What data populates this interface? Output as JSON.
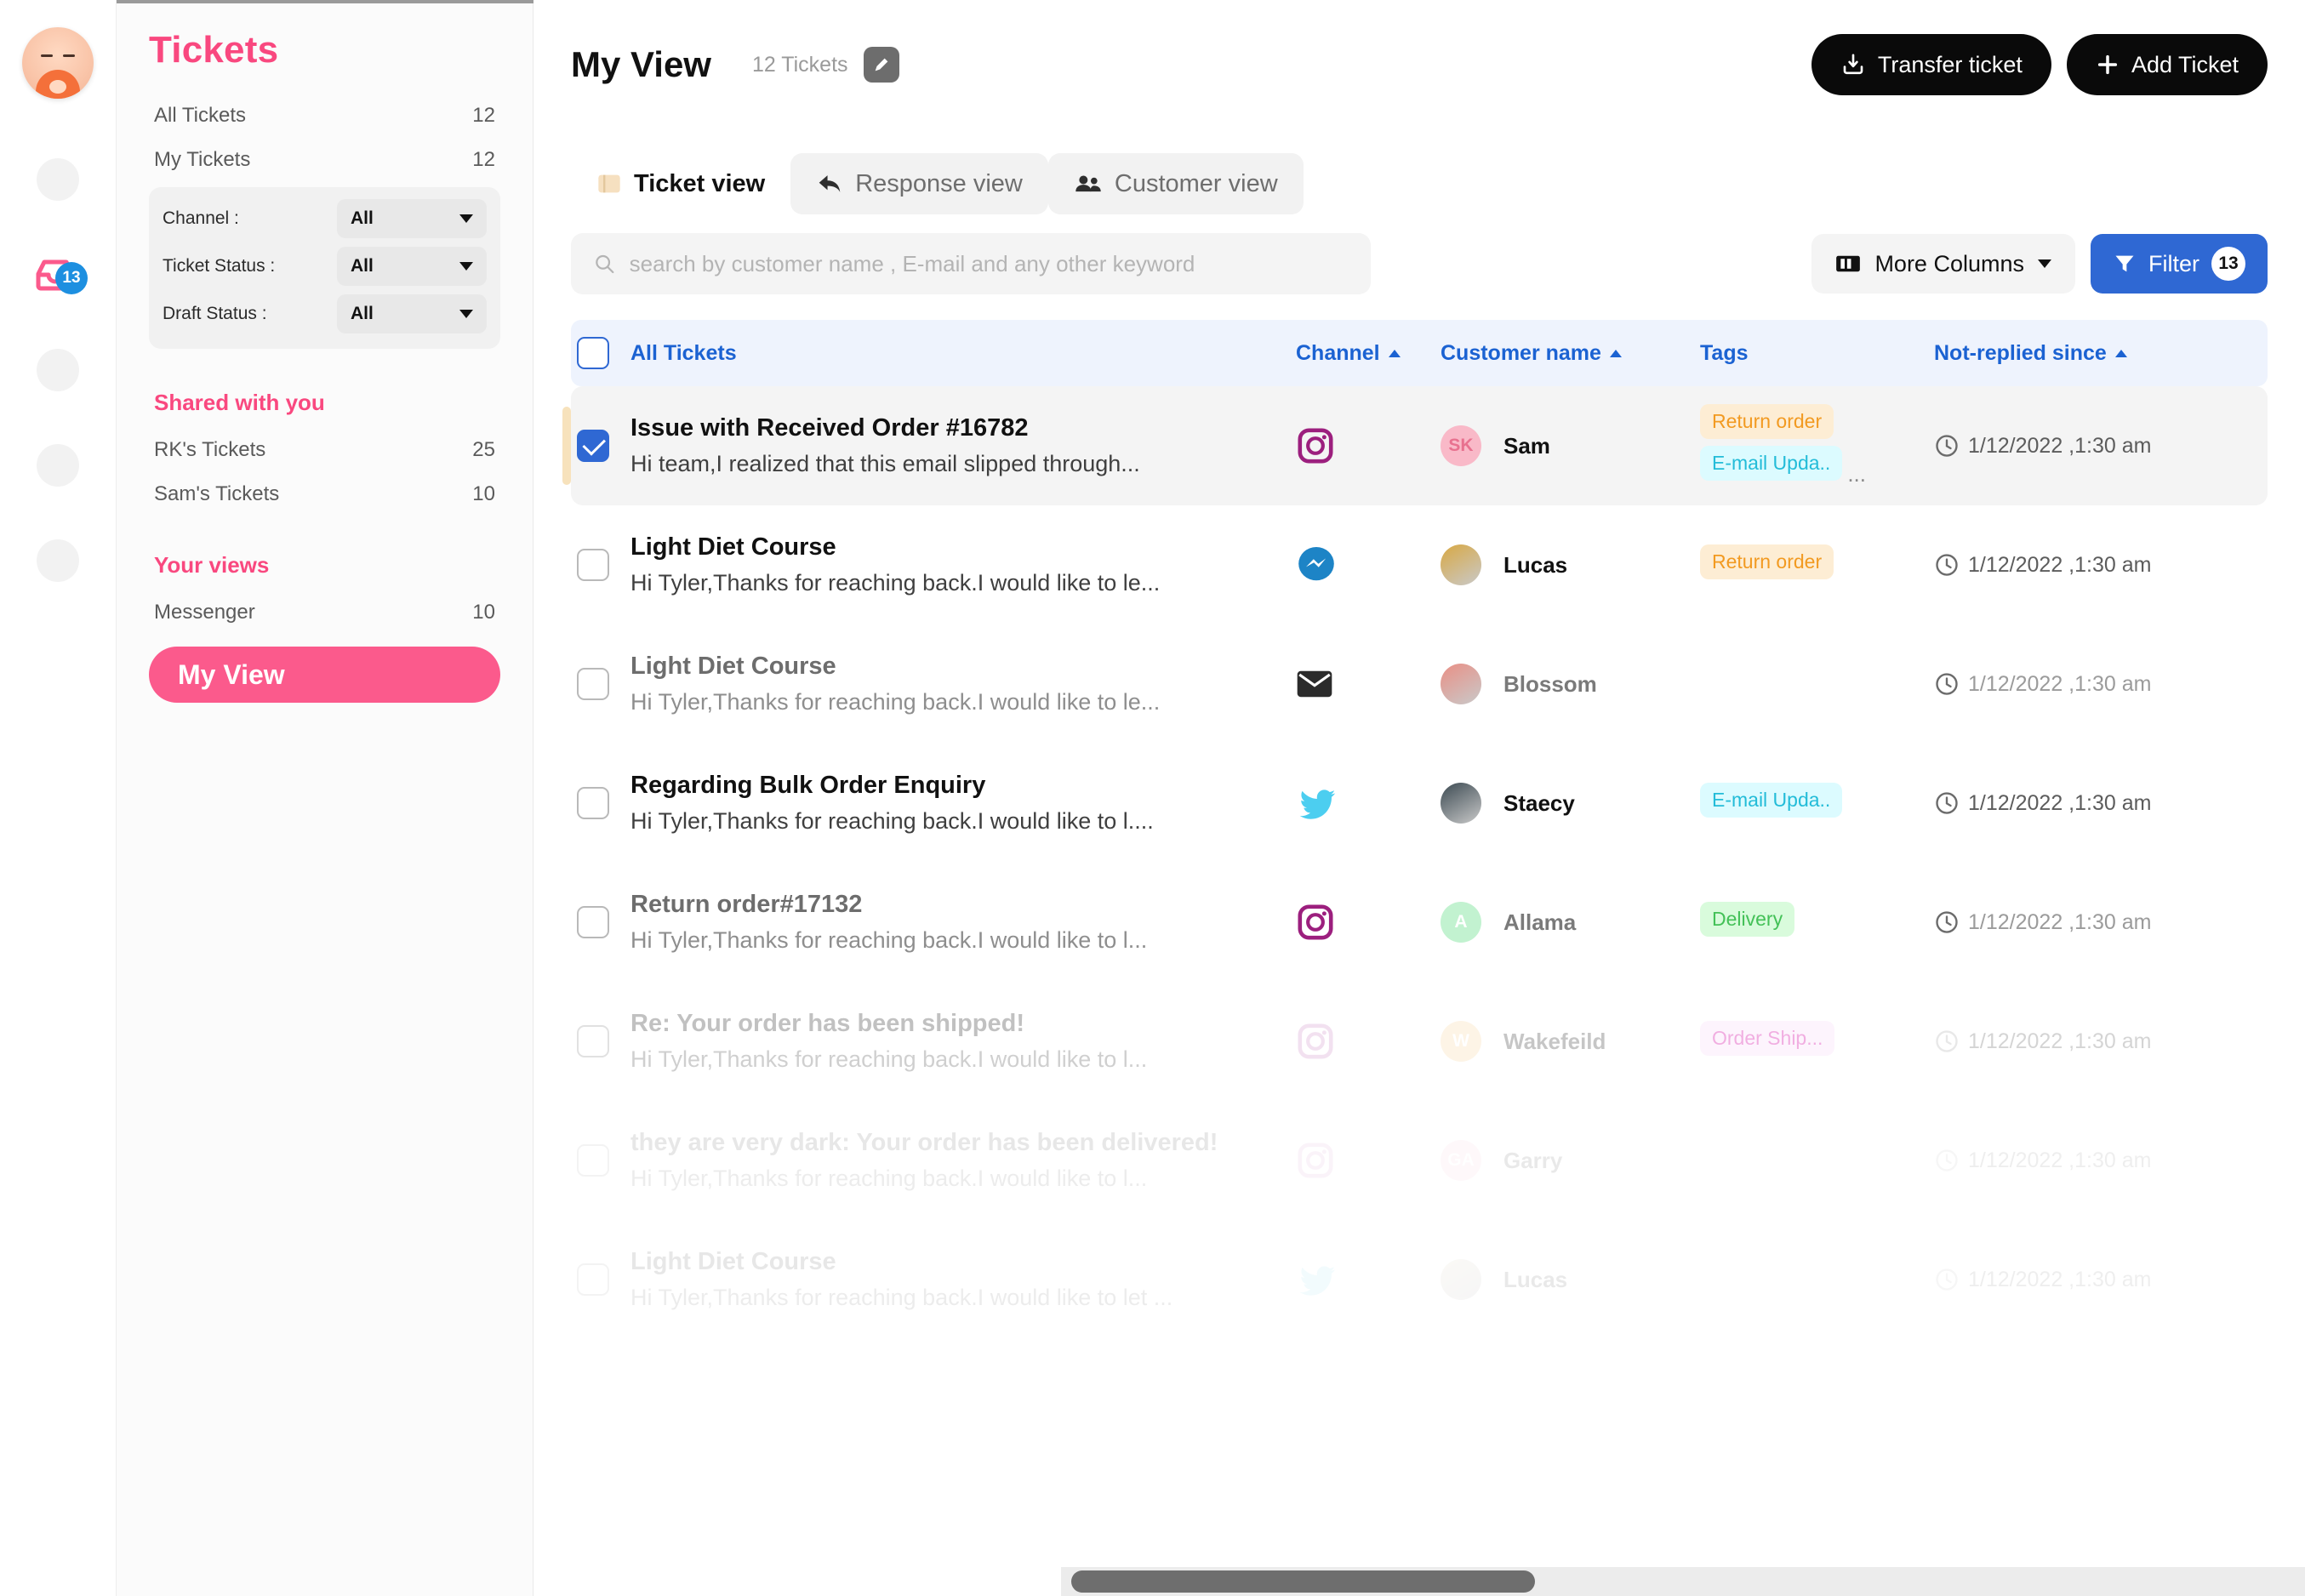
{
  "rail": {
    "avatar_name": "user-avatar",
    "inbox_badge": "13",
    "dots": [
      "rail-dot-1",
      "rail-dot-2",
      "rail-dot-3",
      "rail-dot-4"
    ]
  },
  "sidebar": {
    "title": "Tickets",
    "primary_items": [
      {
        "label": "All Tickets",
        "count": "12"
      },
      {
        "label": "My Tickets",
        "count": "12"
      }
    ],
    "filters": [
      {
        "label": "Channel :",
        "value": "All"
      },
      {
        "label": "Ticket Status :",
        "value": "All"
      },
      {
        "label": "Draft Status :",
        "value": "All"
      }
    ],
    "shared_heading": "Shared with you",
    "shared_items": [
      {
        "label": "RK's Tickets",
        "count": "25"
      },
      {
        "label": "Sam's Tickets",
        "count": "10"
      }
    ],
    "views_heading": "Your views",
    "view_items": [
      {
        "label": "Messenger",
        "count": "10"
      }
    ],
    "active_view": "My View"
  },
  "header": {
    "title": "My View",
    "ticket_count": "12 Tickets",
    "edit_icon": "pencil-icon",
    "transfer_button": "Transfer ticket",
    "transfer_icon": "download-tray-icon",
    "add_button": "Add Ticket",
    "add_icon": "plus-icon"
  },
  "tabs": [
    {
      "label": "Ticket view",
      "icon": "ticket-icon",
      "active": true
    },
    {
      "label": "Response view",
      "icon": "reply-arrow-icon",
      "active": false
    },
    {
      "label": "Customer view",
      "icon": "users-icon",
      "active": false
    }
  ],
  "search": {
    "placeholder": "search by customer name , E-mail and any other keyword",
    "value": "",
    "icon": "search-icon"
  },
  "toolbar": {
    "more_columns_label": "More Columns",
    "more_columns_icon": "columns-icon",
    "filter_label": "Filter",
    "filter_icon": "funnel-icon",
    "filter_count": "13"
  },
  "table": {
    "select_all_label": "All Tickets",
    "columns": [
      {
        "label": "Channel",
        "sortable": true
      },
      {
        "label": "Customer name",
        "sortable": true
      },
      {
        "label": "Tags",
        "sortable": false
      },
      {
        "label": "Not-replied since",
        "sortable": true
      }
    ],
    "rows": [
      {
        "checked": true,
        "subject": "Issue with Received Order #16782",
        "snippet": "Hi team,I realized that this email slipped through...",
        "channel": "instagram",
        "customer": "Sam",
        "avatar_initials": "SK",
        "avatar_bg": "#f9b9c8",
        "avatar_fg": "#e8718f",
        "tags": [
          {
            "label": "Return order",
            "bg": "#fdedd4",
            "fg": "#f29a21"
          },
          {
            "label": "E-mail Upda..",
            "bg": "#dcfbff",
            "fg": "#23bcd8"
          }
        ],
        "tags_overflow": "...",
        "time": "1/12/2022 ,1:30 am",
        "state": "selected"
      },
      {
        "checked": false,
        "subject": "Light Diet Course",
        "snippet": "Hi Tyler,Thanks for reaching back.I would like to le...",
        "channel": "messenger",
        "customer": "Lucas",
        "avatar_initials": "",
        "avatar_bg": "#d8a843",
        "avatar_fg": "#ffffff",
        "tags": [
          {
            "label": "Return order",
            "bg": "#fdedd4",
            "fg": "#f29a21"
          }
        ],
        "tags_overflow": "",
        "time": "1/12/2022 ,1:30 am",
        "state": "normal"
      },
      {
        "checked": false,
        "subject": "Light Diet Course",
        "snippet": "Hi Tyler,Thanks for reaching back.I would like to le...",
        "channel": "email",
        "customer": "Blossom",
        "avatar_initials": "",
        "avatar_bg": "#e98f85",
        "avatar_fg": "#ffffff",
        "tags": [],
        "tags_overflow": "",
        "time": "1/12/2022 ,1:30 am",
        "state": "dim"
      },
      {
        "checked": false,
        "subject": "Regarding Bulk Order Enquiry",
        "snippet": "Hi Tyler,Thanks for reaching back.I would like to l....",
        "channel": "twitter",
        "customer": "Staecy",
        "avatar_initials": "",
        "avatar_bg": "#3c4a52",
        "avatar_fg": "#ffffff",
        "tags": [
          {
            "label": "E-mail Upda..",
            "bg": "#dcfbff",
            "fg": "#23bcd8"
          }
        ],
        "tags_overflow": "",
        "time": "1/12/2022 ,1:30 am",
        "state": "normal"
      },
      {
        "checked": false,
        "subject": "Return order#17132",
        "snippet": "Hi Tyler,Thanks for reaching back.I would like to l...",
        "channel": "instagram",
        "customer": "Allama",
        "avatar_initials": "A",
        "avatar_bg": "#c2f2d0",
        "avatar_fg": "#ffffff",
        "tags": [
          {
            "label": "Delivery",
            "bg": "#d9fbdc",
            "fg": "#43c157"
          }
        ],
        "tags_overflow": "",
        "time": "1/12/2022 ,1:30 am",
        "state": "dim"
      },
      {
        "checked": false,
        "subject": "Re: Your order has been shipped!",
        "snippet": "Hi Tyler,Thanks for reaching back.I would like to l...",
        "channel": "instagram",
        "customer": "Wakefeild",
        "avatar_initials": "W",
        "avatar_bg": "#fbe6c6",
        "avatar_fg": "#ffffff",
        "tags": [
          {
            "label": "Order Ship...",
            "bg": "#fbe6fb",
            "fg": "#de41ba"
          }
        ],
        "tags_overflow": "",
        "time": "1/12/2022 ,1:30 am",
        "state": "fade"
      },
      {
        "checked": false,
        "subject": "they are very dark: Your order has been delivered!",
        "snippet": "Hi Tyler,Thanks for reaching back.I would like to l...",
        "channel": "instagram",
        "customer": "Garry",
        "avatar_initials": "GA",
        "avatar_bg": "#fbd9e2",
        "avatar_fg": "#ffffff",
        "tags": [],
        "tags_overflow": "",
        "time": "1/12/2022 ,1:30 am",
        "state": "fade2"
      },
      {
        "checked": false,
        "subject": "Light Diet Course",
        "snippet": "Hi Tyler,Thanks for reaching back.I would like to let ...",
        "channel": "twitter",
        "customer": "Lucas",
        "avatar_initials": "",
        "avatar_bg": "#e7dfcf",
        "avatar_fg": "#ffffff",
        "tags": [],
        "tags_overflow": "",
        "time": "1/12/2022 ,1:30 am",
        "state": "fade2"
      }
    ]
  }
}
